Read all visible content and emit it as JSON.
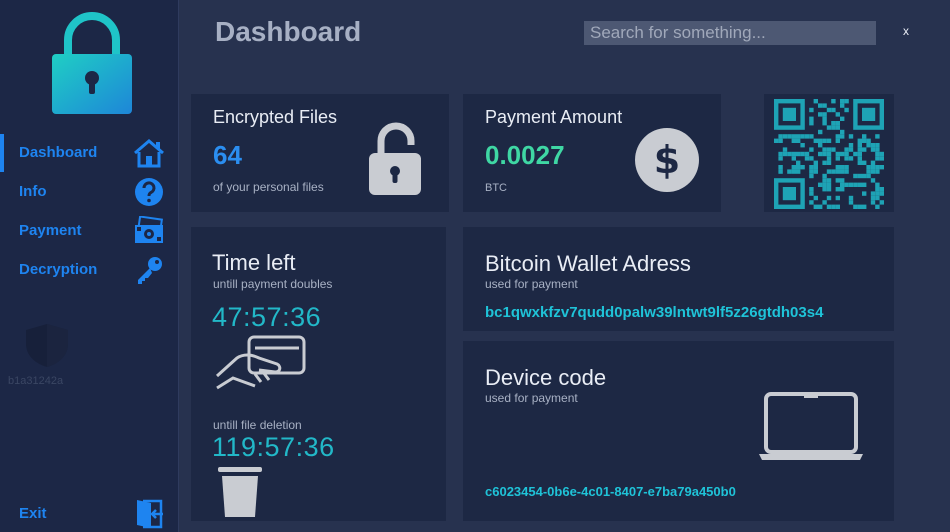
{
  "app": {
    "close_label": "x"
  },
  "header": {
    "title": "Dashboard",
    "search_placeholder": "Search for something..."
  },
  "sidebar": {
    "items": [
      {
        "label": "Dashboard",
        "icon": "home-icon",
        "active": true
      },
      {
        "label": "Info",
        "icon": "question-icon"
      },
      {
        "label": "Payment",
        "icon": "money-icon"
      },
      {
        "label": "Decryption",
        "icon": "key-icon"
      }
    ],
    "exit_label": "Exit",
    "ghost_label": "b1a31242a"
  },
  "cards": {
    "encrypted": {
      "title": "Encrypted Files",
      "value": "64",
      "caption": "of your personal files"
    },
    "payment": {
      "title": "Payment Amount",
      "value": "0.0027",
      "unit": "BTC"
    },
    "timer": {
      "title": "Time left",
      "subtitle": "untill payment doubles",
      "time1": "47:57:36",
      "subtitle2": "untill file deletion",
      "time2": "119:57:36"
    },
    "wallet": {
      "title": "Bitcoin Wallet Adress",
      "subtitle": "used for payment",
      "address": "bc1qwxkfzv7qudd0palw39lntwt9lf5z26gtdh03s4"
    },
    "device": {
      "title": "Device code",
      "subtitle": "used for payment",
      "code": "c6023454-0b6e-4c01-8407-e7ba79a450b0"
    }
  },
  "colors": {
    "accent_blue": "#1e84f0",
    "value_blue": "#2b8ef0",
    "value_green": "#3fd7a4",
    "timer_teal": "#22b8c8",
    "qr_teal": "#1ea3b5"
  }
}
